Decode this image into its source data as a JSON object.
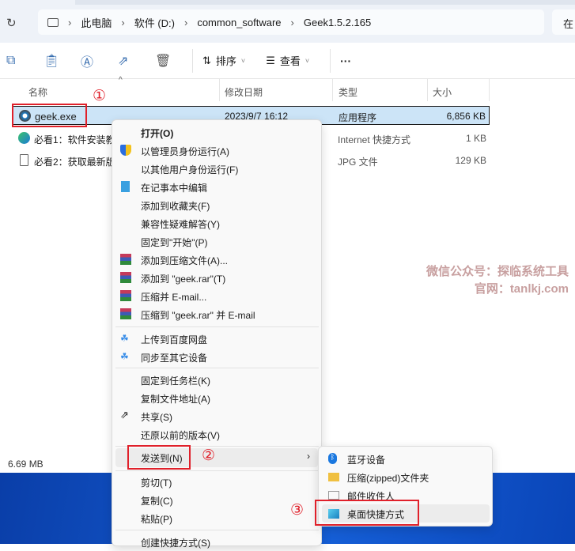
{
  "address": {
    "breadcrumbs": [
      "此电脑",
      "软件 (D:)",
      "common_software",
      "Geek1.5.2.165"
    ],
    "search_placeholder": "在"
  },
  "toolbar": {
    "sort": "排序",
    "view": "查看",
    "more": "···"
  },
  "columns": {
    "name": "名称",
    "date": "修改日期",
    "type": "类型",
    "size": "大小"
  },
  "files": [
    {
      "name": "geek.exe",
      "date": "2023/9/7 16:12",
      "type": "应用程序",
      "size": "6,856 KB"
    },
    {
      "name": "必看1：软件安装教",
      "date": "",
      "type": "Internet 快捷方式",
      "size": "1 KB"
    },
    {
      "name": "必看2：获取最新版",
      "date": "",
      "type": "JPG 文件",
      "size": "129 KB"
    }
  ],
  "status": {
    "size": "6.69 MB"
  },
  "context_menu": {
    "items": [
      "打开(O)",
      "以管理员身份运行(A)",
      "以其他用户身份运行(F)",
      "在记事本中编辑",
      "添加到收藏夹(F)",
      "兼容性疑难解答(Y)",
      "固定到\"开始\"(P)",
      "添加到压缩文件(A)...",
      "添加到 \"geek.rar\"(T)",
      "压缩并 E-mail...",
      "压缩到 \"geek.rar\" 并 E-mail",
      "上传到百度网盘",
      "同步至其它设备",
      "固定到任务栏(K)",
      "复制文件地址(A)",
      "共享(S)",
      "还原以前的版本(V)",
      "发送到(N)",
      "剪切(T)",
      "复制(C)",
      "粘贴(P)",
      "创建快捷方式(S)"
    ]
  },
  "submenu": {
    "items": [
      "蓝牙设备",
      "压缩(zipped)文件夹",
      "邮件收件人",
      "桌面快捷方式"
    ]
  },
  "annotations": {
    "step1": "①",
    "step2": "②",
    "step3": "③"
  },
  "watermark": {
    "line1": "微信公众号：探临系统工具",
    "line2": "官网：tanlkj.com"
  }
}
